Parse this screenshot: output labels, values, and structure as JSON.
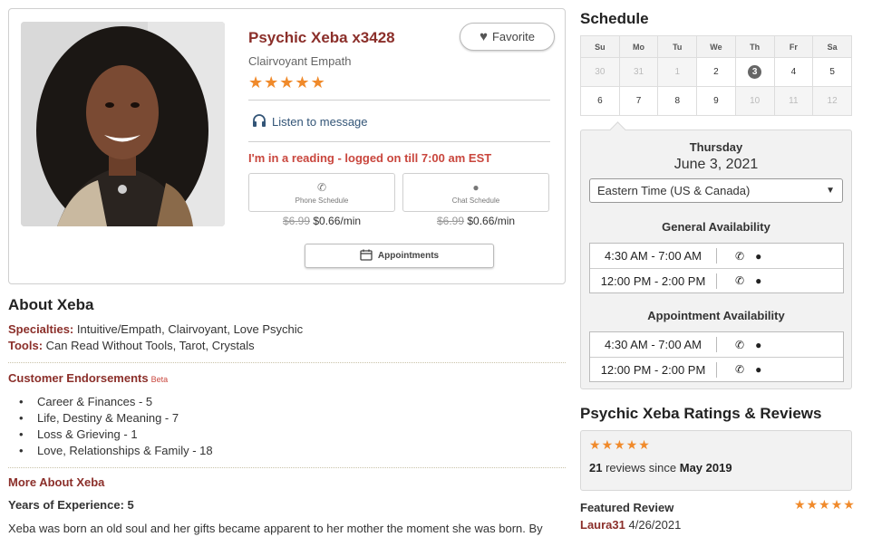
{
  "profile": {
    "name": "Psychic Xeba x3428",
    "subtitle": "Clairvoyant Empath",
    "rating_stars": 5,
    "favorite_label": "Favorite",
    "listen_label": "Listen to message",
    "status": "I'm in a reading - logged on till 7:00 am EST",
    "phone_schedule_label": "Phone Schedule",
    "chat_schedule_label": "Chat Schedule",
    "phone_old_price": "$6.99",
    "phone_price": "$0.66/min",
    "chat_old_price": "$6.99",
    "chat_price": "$0.66/min",
    "appointments_label": "Appointments"
  },
  "about": {
    "title": "About Xeba",
    "specialties_label": "Specialties:",
    "specialties": "Intuitive/Empath, Clairvoyant, Love Psychic",
    "tools_label": "Tools:",
    "tools": "Can Read Without Tools, Tarot, Crystals",
    "endorsements_title": "Customer Endorsements",
    "endorsements_beta": "Beta",
    "endorsements": [
      "Career & Finances - 5",
      "Life, Destiny & Meaning - 7",
      "Loss & Grieving - 1",
      "Love, Relationships & Family - 18"
    ],
    "more_title": "More About Xeba",
    "years_experience": "Years of Experience: 5",
    "bio": "Xeba was born an old soul and her gifts became apparent to her mother the moment she was born. By"
  },
  "schedule": {
    "title": "Schedule",
    "weekdays": [
      "Su",
      "Mo",
      "Tu",
      "We",
      "Th",
      "Fr",
      "Sa"
    ],
    "week1": [
      "30",
      "31",
      "1",
      "2",
      "3",
      "4",
      "5"
    ],
    "week2": [
      "6",
      "7",
      "8",
      "9",
      "10",
      "11",
      "12"
    ],
    "selected_day": "Thursday",
    "selected_date": "June 3, 2021",
    "timezone": "Eastern Time (US & Canada)",
    "general_heading": "General Availability",
    "general_slots": [
      "4:30 AM - 7:00 AM",
      "12:00 PM - 2:00 PM"
    ],
    "appointment_heading": "Appointment Availability",
    "appointment_slots": [
      "4:30 AM - 7:00 AM",
      "12:00 PM - 2:00 PM"
    ]
  },
  "reviews": {
    "title": "Psychic Xeba Ratings & Reviews",
    "rating_stars": 5,
    "count": "21",
    "count_text": "reviews since",
    "since": "May 2019",
    "featured_title": "Featured Review",
    "featured_stars": 5,
    "reviewer": "Laura31",
    "review_date": "4/26/2021"
  },
  "colors": {
    "accent": "#8b2f2a",
    "status_red": "#c9463d",
    "star_orange": "#f08a2b"
  }
}
